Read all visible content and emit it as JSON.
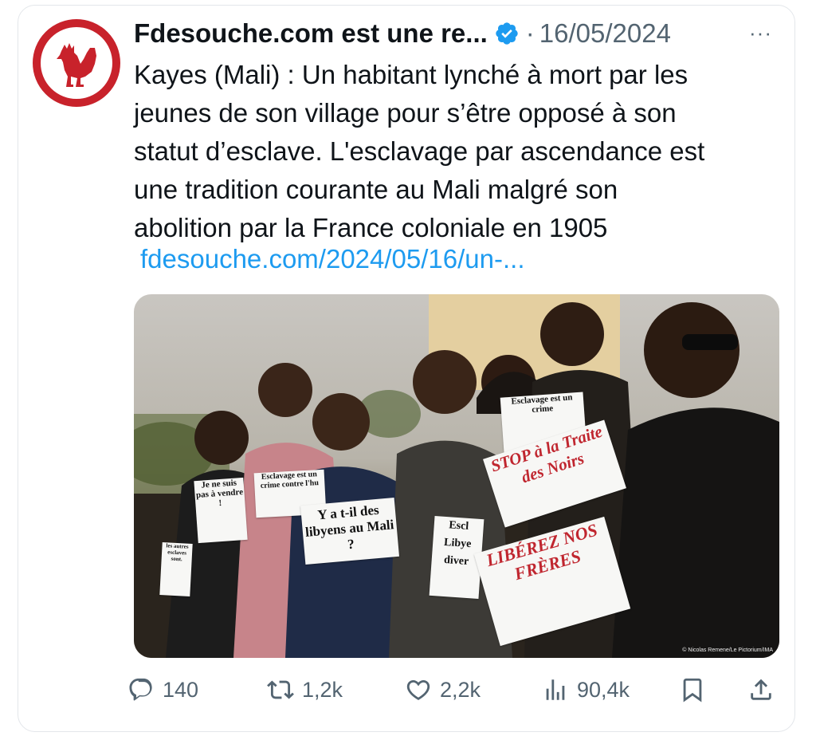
{
  "tweet": {
    "author_name": "Fdesouche.com est une re...",
    "separator": "·",
    "date": "16/05/2024",
    "more_label": "···",
    "text_lines": [
      "Kayes (Mali) : Un habitant lynché à mort par les",
      "jeunes de son village pour s’être opposé à son",
      "statut d’esclave. L'esclavage par ascendance est",
      "une tradition courante au Mali malgré son",
      "abolition par la France coloniale en 1905"
    ],
    "link": "fdesouche.com/2024/05/16/un-..."
  },
  "media": {
    "signs": {
      "s1": "Je ne suis pas à vendre !",
      "s2": "Esclavage est un crime contre l'hu",
      "s3": "Y a t-il des libyens au Mali ?",
      "s4": "Esclavage est un crime",
      "s5": "Escl Libye diver",
      "s6": "STOP à la Traite des Noirs",
      "s7": "LIBÉREZ NOS FRÈRES",
      "s8": "les autres esclaves sont."
    },
    "credit": "© Nicolas Remene/Le Pictorium/IMA"
  },
  "actions": {
    "replies": "140",
    "retweets": "1,2k",
    "likes": "2,2k",
    "views": "90,4k"
  },
  "icons": {
    "avatar": "rooster-icon",
    "verified": "verified-badge-icon",
    "reply": "reply-icon",
    "retweet": "retweet-icon",
    "like": "heart-icon",
    "views": "views-chart-icon",
    "bookmark": "bookmark-icon",
    "share": "share-icon"
  },
  "colors": {
    "accent": "#1d9bf0",
    "brand_red": "#c8222b",
    "muted": "#536471"
  }
}
